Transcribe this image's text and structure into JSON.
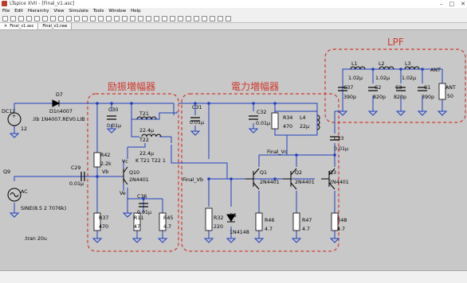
{
  "window": {
    "title": "LTspice XVII - [Final_v1.asc]",
    "controls": [
      "–",
      "□",
      "✕"
    ]
  },
  "menu": [
    "File",
    "Edit",
    "Hierarchy",
    "View",
    "Simulate",
    "Tools",
    "Window",
    "Help"
  ],
  "tabs": [
    {
      "label": "Final_v1.asc",
      "close": "✕"
    },
    {
      "label": "Final_v1.raw",
      "close": ""
    }
  ],
  "schematic": {
    "sections": {
      "exciter": "励振増幅器",
      "power": "電力増幅器",
      "lpf": "LPF"
    },
    "labels": {
      "d7": "D7",
      "d1n4007": "D1n4007",
      "dc12": "DC12",
      "lib": ".lib 1N4007.REV0.LIB",
      "v12": "12",
      "c30": "C30",
      "c30v": "0.01μ",
      "t21": "T21",
      "t21v": "22.4μ",
      "t22": "T22",
      "t22v": "22.4μ",
      "k": "K T21 T22 1",
      "vc": "Vc",
      "ve": "Ve",
      "vb": "Vb",
      "r42": "R42",
      "r42v": "2.2k",
      "q9": "Q9",
      "c29": "C29",
      "c29v": "0.01μ",
      "ac": "AC",
      "sine": "SINE(8.5 2 7076k)",
      "q10": "Q10",
      "q10v": "2N4401",
      "c36": "C36",
      "c36v": "0.01μ",
      "r37": "R37",
      "r37v": "470",
      "r11": "R11",
      "r11v": "47",
      "r45": "R45",
      "r45v": "4.7",
      "tran": ".tran 20u",
      "c31": "C31",
      "c31v": "0.01μ",
      "c32": "C32",
      "c32v": "0.01μ",
      "r34": "R34",
      "r34v": "470",
      "l4": "L4",
      "l4v": "22μ",
      "finalvc": "Final_Vc",
      "finalvb": "Final_Vb",
      "q1": "Q1",
      "q1v": "2N4401",
      "q2": "Q2",
      "q2v": "2N4401",
      "q3": "Q3",
      "q3v": "2N4401",
      "c33": "C33",
      "c33v": "0.01μ",
      "r32": "R32",
      "r32v": "220",
      "d5": "D5",
      "d5v": "1N4148",
      "r46": "R46",
      "r46v": "4.7",
      "r47": "R47",
      "r47v": "4.7",
      "r48": "R48",
      "r48v": "4.7",
      "l1": "L1",
      "l1v": "1.02μ",
      "l2": "L2",
      "l2v": "1.02μ",
      "l3": "L3",
      "l3v": "1.02μ",
      "ant": "ANT",
      "c37": "C37",
      "c37v": "390p",
      "c2": "C2",
      "c2v": "820p",
      "c3": "C3",
      "c3v": "820p",
      "c1": "C1",
      "c1v": "390p",
      "antr": "ANT",
      "antrv": "50"
    }
  },
  "colors": {
    "wire": "#1f3fbf",
    "text": "#000000",
    "dashed": "#d03a2f",
    "canvas": "#c8c8c8",
    "ground": "#1f3fbf"
  }
}
